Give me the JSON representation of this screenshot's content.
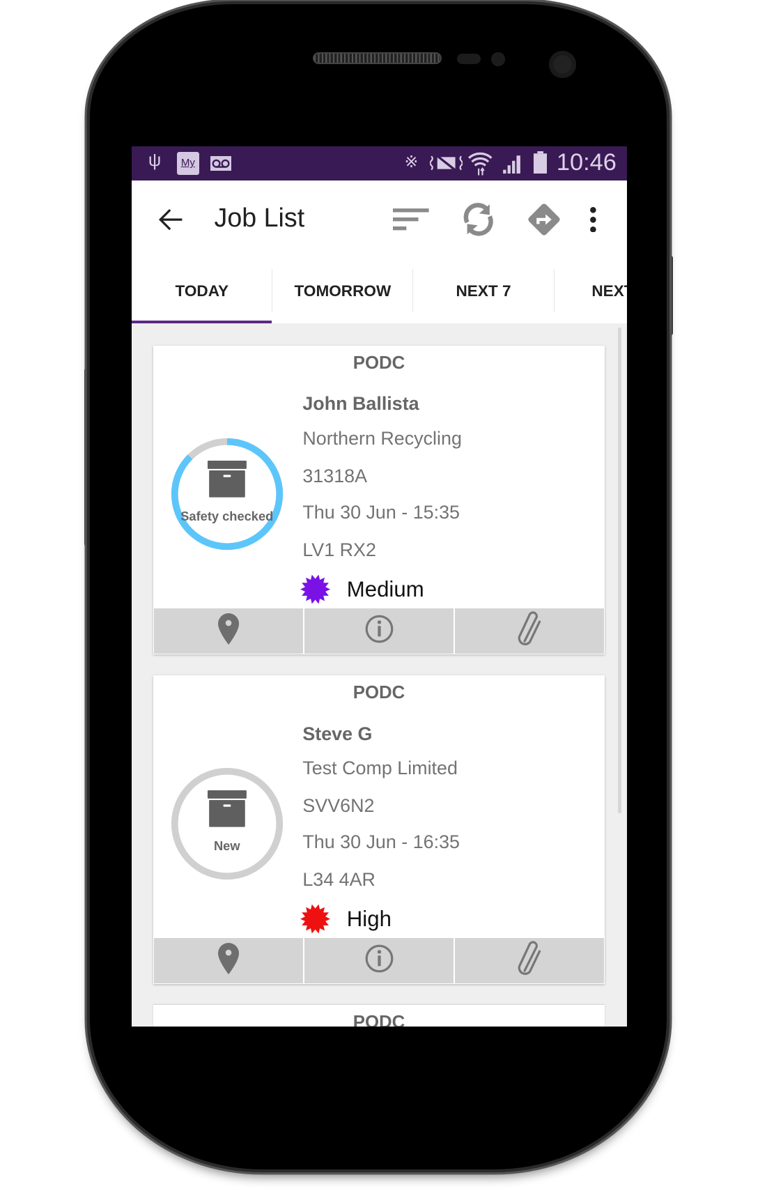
{
  "status_bar": {
    "time": "10:46",
    "left_icons": [
      "usb-icon",
      "my-app-icon",
      "voicemail-icon"
    ],
    "right_icons": [
      "bluetooth-icon",
      "vibrate-mute-icon",
      "wifi-icon",
      "signal-icon",
      "battery-icon"
    ],
    "my_label": "My",
    "color": "#3a1a55"
  },
  "toolbar": {
    "title": "Job List",
    "icons": [
      "back-arrow-icon",
      "sort-icon",
      "sync-icon",
      "directions-icon",
      "more-vert-icon"
    ]
  },
  "tabs": [
    {
      "label": "TODAY",
      "selected": true
    },
    {
      "label": "TOMORROW"
    },
    {
      "label": "NEXT 7"
    },
    {
      "label": "NEXT"
    }
  ],
  "accent": "#5b2a86",
  "jobs": [
    {
      "type": "PODC",
      "name": "John Ballista",
      "company": "Northern Recycling",
      "ref": "31318A",
      "datetime": "Thu 30 Jun - 15:35",
      "postcode": "LV1 RX2",
      "priority": "Medium",
      "priority_color": "#7a12e6",
      "status": "Safety checked",
      "progress": 0.875,
      "ring_color": "#5cc6fa"
    },
    {
      "type": "PODC",
      "name": "Steve G",
      "company": "Test Comp Limited",
      "ref": "SVV6N2",
      "datetime": "Thu 30 Jun - 16:35",
      "postcode": "L34 4AR",
      "priority": "High",
      "priority_color": "#ee1111",
      "status": "New",
      "progress": 0,
      "ring_color": "#5cc6fa"
    },
    {
      "type": "PODC"
    }
  ],
  "card_actions": [
    "map-pin-icon",
    "info-icon",
    "attachment-icon"
  ]
}
